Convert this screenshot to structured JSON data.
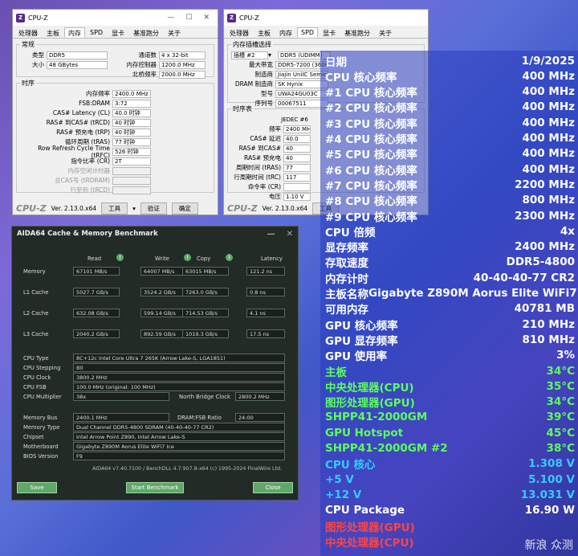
{
  "cpuz1": {
    "title": "CPU-Z",
    "tabs": [
      "处理器",
      "主板",
      "内存",
      "SPD",
      "显卡",
      "基准跑分",
      "关于"
    ],
    "active_tab": 2,
    "general_legend": "常规",
    "type_label": "类型",
    "type_value": "DDR5",
    "size_label": "大小",
    "size_value": "48 GBytes",
    "channels_label": "通道数",
    "channels_value": "4 x 32-bit",
    "mc_label": "内存控制器",
    "mc_value": "1200.0 MHz",
    "nb_label": "北桥频率",
    "nb_value": "2000.0 MHz",
    "timing_legend": "时序",
    "timings": [
      {
        "label": "内存频率",
        "value": "2400.0 MHz"
      },
      {
        "label": "FSB:DRAM",
        "value": "3:72"
      },
      {
        "label": "CAS# Latency (CL)",
        "value": "40.0 时钟"
      },
      {
        "label": "RAS# 到CAS# (tRCD)",
        "value": "40 时钟"
      },
      {
        "label": "RAS# 预充电 (tRP)",
        "value": "40 时钟"
      },
      {
        "label": "循环周期 (tRAS)",
        "value": "77 时钟"
      },
      {
        "label": "Row Refresh Cycle Time (tRFC)",
        "value": "526 时钟"
      },
      {
        "label": "指令比率 (CR)",
        "value": "2T"
      },
      {
        "label": "内存空闲计时器",
        "value": ""
      },
      {
        "label": "总CAS号 (tRDRAM)",
        "value": ""
      },
      {
        "label": "行至列 (tRCD)",
        "value": ""
      }
    ],
    "logo": "CPU-Z",
    "version": "Ver. 2.13.0.x64",
    "tools_btn": "工具",
    "validate_btn": "验证",
    "ok_btn": "确定"
  },
  "cpuz2": {
    "title": "CPU-Z",
    "tabs": [
      "处理器",
      "主板",
      "内存",
      "SPD",
      "显卡",
      "基准跑分",
      "关于"
    ],
    "active_tab": 3,
    "slot_legend": "内存插槽选择",
    "slot_value": "插槽 #2",
    "slot_type": "DDR5 (UDIMM)",
    "max_bw_label": "最大带宽",
    "max_bw_value": "DDR5-7200 (3600",
    "mfr_label": "制造商",
    "mfr_value": "Jiajin UniIC Semico",
    "dram_mfr_label": "DRAM 制造商",
    "dram_mfr_value": "SK Hynix",
    "model_label": "型号",
    "model_value": "UWA24GU03C",
    "serial_label": "序列号",
    "serial_value": "00067511",
    "timing_legend": "时序表",
    "jedec_header": "JEDEC #6",
    "rows": [
      {
        "label": "频率",
        "value": "2400 MHz"
      },
      {
        "label": "CAS# 延迟",
        "value": "40.0"
      },
      {
        "label": "RAS# 到CAS#",
        "value": "40"
      },
      {
        "label": "RAS# 预充电",
        "value": "40"
      },
      {
        "label": "周期时间 (tRAS)",
        "value": "77"
      },
      {
        "label": "行周期时间 (tRC)",
        "value": "117"
      },
      {
        "label": "命令率 (CR)",
        "value": ""
      },
      {
        "label": "电压",
        "value": "1.10 V"
      }
    ],
    "logo": "CPU-Z",
    "version": "Ver. 2.13.0.x64",
    "tools_btn": "工具"
  },
  "aida": {
    "title": "AIDA64 Cache & Memory Benchmark",
    "col_headers": [
      "Read",
      "Write",
      "Copy",
      "Latency"
    ],
    "bench_rows": [
      {
        "label": "Memory",
        "values": [
          "67101 MB/s",
          "64007 MB/s",
          "63015 MB/s",
          "121.2 ns"
        ]
      },
      {
        "label": "L1 Cache",
        "values": [
          "5027.7 GB/s",
          "3524.2 GB/s",
          "7263.0 GB/s",
          "0.8 ns"
        ]
      },
      {
        "label": "L2 Cache",
        "values": [
          "632.08 GB/s",
          "599.14 GB/s",
          "714.53 GB/s",
          "4.1 ns"
        ]
      },
      {
        "label": "L3 Cache",
        "values": [
          "2040.2 GB/s",
          "892.59 GB/s",
          "1019.3 GB/s",
          "17.5 ns"
        ]
      }
    ],
    "cpu_type_label": "CPU Type",
    "cpu_type": "8C+12c Intel Core Ultra 7 265K  (Arrow Lake-S, LGA1851)",
    "cpu_step_label": "CPU Stepping",
    "cpu_step": "B0",
    "cpu_clock_label": "CPU Clock",
    "cpu_clock": "3800.2 MHz",
    "cpu_fsb_label": "CPU FSB",
    "cpu_fsb": "100.0 MHz  (original: 100 MHz)",
    "cpu_mult_label": "CPU Multiplier",
    "cpu_mult": "38x",
    "nb_clock_label": "North Bridge Clock",
    "nb_clock": "2800.2 MHz",
    "mem_bus_label": "Memory Bus",
    "mem_bus": "2400.1 MHz",
    "dram_ratio_label": "DRAM:FSB Ratio",
    "dram_ratio": "24:00",
    "mem_type_label": "Memory Type",
    "mem_type": "Dual Channel DDR5-4800 SDRAM  (40-40-40-77 CR2)",
    "chipset_label": "Chipset",
    "chipset": "Intel Arrow Point Z890, Intel Arrow Lake-S",
    "mobo_label": "Motherboard",
    "mobo": "Gigabyte Z890M Aorus Elite WiFi7 Ice",
    "bios_label": "BIOS Version",
    "bios": "F9",
    "footer": "AIDA64 v7.40.7100 / BenchDLL 4.7.907.8-x64  (c) 1995-2024 FinalWire Ltd.",
    "save_btn": "Save",
    "start_btn": "Start Benchmark",
    "close_btn": "Close"
  },
  "overlay": [
    {
      "label": "日期",
      "value": "1/9/2025",
      "color": "#ffffff"
    },
    {
      "label": "CPU 核心频率",
      "value": "400 MHz",
      "color": "#ffffff"
    },
    {
      "label": "#1 CPU 核心频率",
      "value": "400 MHz",
      "color": "#ffffff"
    },
    {
      "label": "#2 CPU 核心频率",
      "value": "400 MHz",
      "color": "#ffffff"
    },
    {
      "label": "#3 CPU 核心频率",
      "value": "400 MHz",
      "color": "#ffffff"
    },
    {
      "label": "#4 CPU 核心频率",
      "value": "400 MHz",
      "color": "#ffffff"
    },
    {
      "label": "#5 CPU 核心频率",
      "value": "400 MHz",
      "color": "#ffffff"
    },
    {
      "label": "#6 CPU 核心频率",
      "value": "400 MHz",
      "color": "#ffffff"
    },
    {
      "label": "#7 CPU 核心频率",
      "value": "2200 MHz",
      "color": "#ffffff"
    },
    {
      "label": "#8 CPU 核心频率",
      "value": "800 MHz",
      "color": "#ffffff"
    },
    {
      "label": "#9 CPU 核心频率",
      "value": "2300 MHz",
      "color": "#ffffff"
    },
    {
      "label": "CPU 倍频",
      "value": "4x",
      "color": "#ffffff"
    },
    {
      "label": "显存频率",
      "value": "2400 MHz",
      "color": "#ffffff"
    },
    {
      "label": "存取速度",
      "value": "DDR5-4800",
      "color": "#ffffff"
    },
    {
      "label": "内存计时",
      "value": "40-40-40-77 CR2",
      "color": "#ffffff"
    },
    {
      "label": "主板名称",
      "value": "Gigabyte Z890M Aorus Elite WiFi7 Ice",
      "color": "#ffffff"
    },
    {
      "label": "可用内存",
      "value": "40781 MB",
      "color": "#ffffff"
    },
    {
      "label": "GPU 核心频率",
      "value": "210 MHz",
      "color": "#ffffff"
    },
    {
      "label": "GPU 显存频率",
      "value": "810 MHz",
      "color": "#ffffff"
    },
    {
      "label": "GPU 使用率",
      "value": "3%",
      "color": "#ffffff"
    },
    {
      "label": "主板",
      "value": "34°C",
      "color": "#5cff5c"
    },
    {
      "label": "中央处理器(CPU)",
      "value": "35°C",
      "color": "#5cff5c"
    },
    {
      "label": "图形处理器(GPU)",
      "value": "34°C",
      "color": "#5cff5c"
    },
    {
      "label": "SHPP41-2000GM",
      "value": "39°C",
      "color": "#5cff5c"
    },
    {
      "label": "GPU Hotspot",
      "value": "45°C",
      "color": "#5cff5c"
    },
    {
      "label": "SHPP41-2000GM #2",
      "value": "38°C",
      "color": "#5cff5c"
    },
    {
      "label": "CPU 核心",
      "value": "1.308 V",
      "color": "#33ccff"
    },
    {
      "label": "+5 V",
      "value": "5.100 V",
      "color": "#33ccff"
    },
    {
      "label": "+12 V",
      "value": "13.031 V",
      "color": "#33ccff"
    },
    {
      "label": "CPU Package",
      "value": "16.90 W",
      "color": "#ffffff"
    },
    {
      "label": "图形处理器(GPU)",
      "value": "",
      "color": "#ff4444"
    },
    {
      "label": "中央处理器(CPU)",
      "value": "",
      "color": "#ff4444"
    }
  ],
  "watermark": "新浪 众测"
}
